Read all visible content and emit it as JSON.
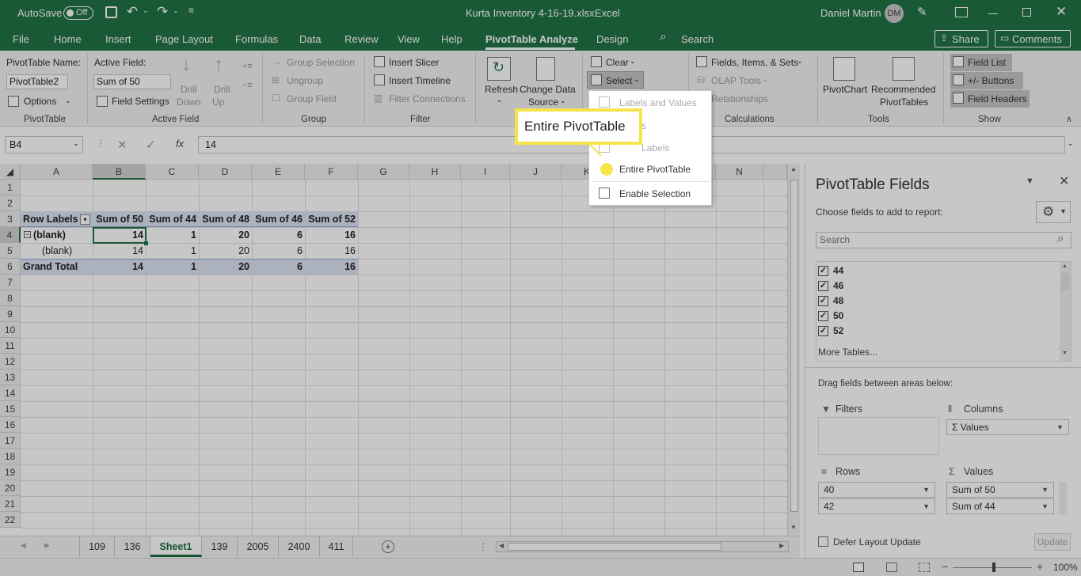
{
  "titlebar": {
    "autosave_label": "AutoSave",
    "autosave_state": "Off",
    "filename": "Kurta Inventory 4-16-19.xlsx",
    "sep": "-",
    "app": "Excel",
    "user": "Daniel Martin",
    "initials": "DM"
  },
  "menu": {
    "items": [
      "File",
      "Home",
      "Insert",
      "Page Layout",
      "Formulas",
      "Data",
      "Review",
      "View",
      "Help",
      "PivotTable Analyze",
      "Design"
    ],
    "search": "Search",
    "share": "Share",
    "comments": "Comments"
  },
  "ribbon": {
    "pivot_name_label": "PivotTable Name:",
    "pivot_name": "PivotTable2",
    "options": "Options",
    "group_pivottable": "PivotTable",
    "active_field_label": "Active Field:",
    "active_field": "Sum of 50",
    "field_settings": "Field Settings",
    "drill_down_1": "Drill",
    "drill_down_2": "Down",
    "drill_up_1": "Drill",
    "drill_up_2": "Up",
    "group_active_field": "Active Field",
    "group_selection": "Group Selection",
    "ungroup": "Ungroup",
    "group_field": "Group Field",
    "group_group": "Group",
    "insert_slicer": "Insert Slicer",
    "insert_timeline": "Insert Timeline",
    "filter_connections": "Filter Connections",
    "group_filter": "Filter",
    "refresh": "Refresh",
    "change_data_1": "Change Data",
    "change_data_2": "Source",
    "clear": "Clear",
    "select": "Select",
    "fields_items": "Fields, Items, & Sets",
    "olap_tools": "OLAP Tools",
    "relationships": "Relationships",
    "group_calculations": "Calculations",
    "pivotchart": "PivotChart",
    "recommended_1": "Recommended",
    "recommended_2": "PivotTables",
    "group_tools": "Tools",
    "field_list": "Field List",
    "pm_buttons": "+/- Buttons",
    "field_headers": "Field Headers",
    "group_show": "Show"
  },
  "dropdown": {
    "labels_values": "Labels and Values",
    "values_partial": "s",
    "labels": "Labels",
    "entire": "Entire PivotTable",
    "enable": "Enable Selection"
  },
  "callout": {
    "text": "Entire PivotTable"
  },
  "formula_bar": {
    "name_box": "B4",
    "fx": "fx",
    "value": "14"
  },
  "grid": {
    "columns": [
      "A",
      "B",
      "C",
      "D",
      "E",
      "F",
      "G",
      "H",
      "I",
      "J",
      "K",
      "L",
      "M",
      "N"
    ],
    "rows": [
      "1",
      "2",
      "3",
      "4",
      "5",
      "6",
      "7",
      "8",
      "9",
      "10",
      "11",
      "12",
      "13",
      "14",
      "15",
      "16",
      "17",
      "18",
      "19",
      "20",
      "21",
      "22"
    ],
    "header": [
      "Row Labels",
      "Sum of 50",
      "Sum of 44",
      "Sum of 48",
      "Sum of 46",
      "Sum of 52"
    ],
    "r4": [
      "(blank)",
      "14",
      "1",
      "20",
      "6",
      "16"
    ],
    "r5": [
      "(blank)",
      "14",
      "1",
      "20",
      "6",
      "16"
    ],
    "r6": [
      "Grand Total",
      "14",
      "1",
      "20",
      "6",
      "16"
    ]
  },
  "sheets": [
    "109",
    "136",
    "Sheet1",
    "139",
    "2005",
    "2400",
    "411"
  ],
  "pane": {
    "title": "PivotTable Fields",
    "choose": "Choose fields to add to report:",
    "search": "Search",
    "fields": [
      "44",
      "46",
      "48",
      "50",
      "52"
    ],
    "more": "More Tables...",
    "drag": "Drag fields between areas below:",
    "filters": "Filters",
    "columns": "Columns",
    "col_value": "Values",
    "rows": "Rows",
    "values": "Values",
    "row_fields": [
      "40",
      "42"
    ],
    "value_fields": [
      "Sum of 50",
      "Sum of 44"
    ],
    "defer": "Defer Layout Update",
    "update": "Update"
  },
  "status": {
    "zoom": "100%"
  },
  "colors": {
    "excel_green": "#217346",
    "highlight_yellow": "#f5e44a",
    "selected_tab": "#1e6b3f"
  }
}
